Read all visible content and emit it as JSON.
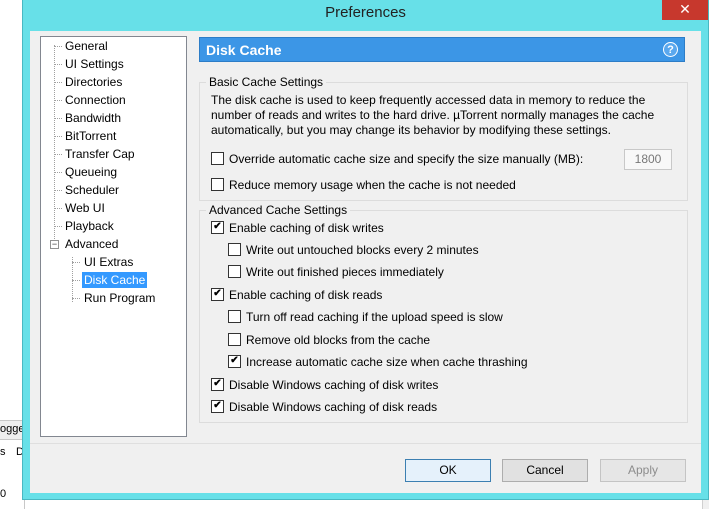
{
  "window": {
    "title": "Preferences",
    "close_glyph": "✕"
  },
  "background_app": {
    "text1": "ogge",
    "text2": "s",
    "text3": "D",
    "text4": "0"
  },
  "tree": {
    "items": [
      {
        "label": "General"
      },
      {
        "label": "UI Settings"
      },
      {
        "label": "Directories"
      },
      {
        "label": "Connection"
      },
      {
        "label": "Bandwidth"
      },
      {
        "label": "BitTorrent"
      },
      {
        "label": "Transfer Cap"
      },
      {
        "label": "Queueing"
      },
      {
        "label": "Scheduler"
      },
      {
        "label": "Web UI"
      },
      {
        "label": "Playback"
      },
      {
        "label": "Advanced",
        "expanded": true
      },
      {
        "label": "UI Extras",
        "child": true
      },
      {
        "label": "Disk Cache",
        "child": true,
        "selected": true
      },
      {
        "label": "Run Program",
        "child": true
      }
    ],
    "expander_glyph": "−"
  },
  "panel": {
    "title": "Disk Cache",
    "help_glyph": "?",
    "basic": {
      "label": "Basic Cache Settings",
      "description": "The disk cache is used to keep frequently accessed data in memory to reduce the number of reads and writes to the hard drive. µTorrent normally manages the cache automatically, but you may change its behavior by modifying these settings.",
      "override_label": "Override automatic cache size and specify the size manually (MB):",
      "override_checked": false,
      "size_value": "1800",
      "reduce_label": "Reduce memory usage when the cache is not needed",
      "reduce_checked": false
    },
    "advanced": {
      "label": "Advanced Cache Settings",
      "options": [
        {
          "label": "Enable caching of disk writes",
          "checked": true
        },
        {
          "label": "Write out untouched blocks every 2 minutes",
          "checked": false
        },
        {
          "label": "Write out finished pieces immediately",
          "checked": false
        },
        {
          "label": "Enable caching of disk reads",
          "checked": true
        },
        {
          "label": "Turn off read caching if the upload speed is slow",
          "checked": false
        },
        {
          "label": "Remove old blocks from the cache",
          "checked": false
        },
        {
          "label": "Increase automatic cache size when cache thrashing",
          "checked": true
        },
        {
          "label": "Disable Windows caching of disk writes",
          "checked": true
        },
        {
          "label": "Disable Windows caching of disk reads",
          "checked": true
        }
      ]
    }
  },
  "buttons": {
    "ok": "OK",
    "cancel": "Cancel",
    "apply": "Apply"
  },
  "colors": {
    "titlebar": "#67e0e8",
    "header": "#3c96e6",
    "selection": "#3399ff",
    "close": "#c7382d"
  }
}
